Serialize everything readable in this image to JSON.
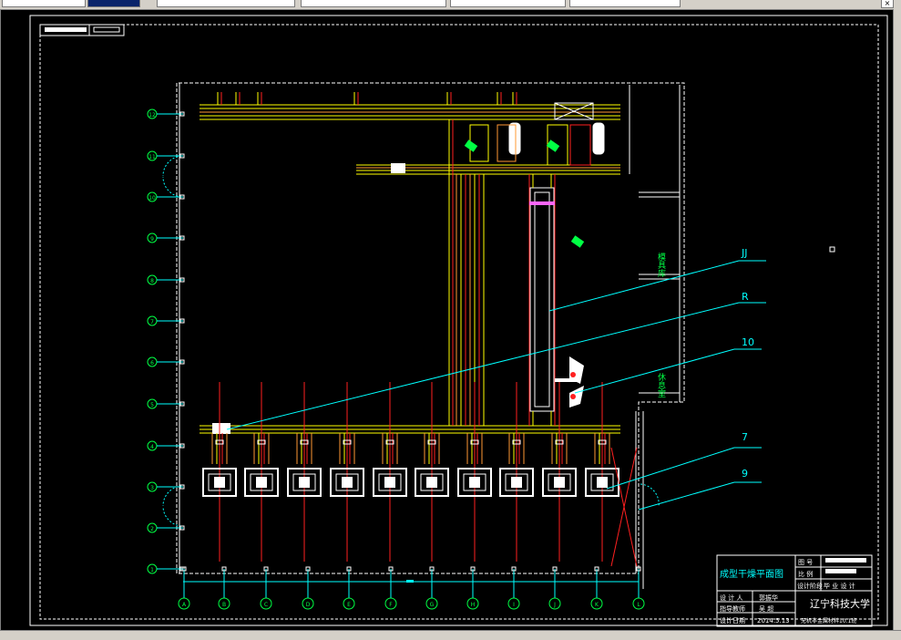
{
  "title_block": {
    "drawing_name": "成型干燥平面图",
    "school": "辽宁科技大学",
    "labels": [
      "设 计 人",
      "指导教师",
      "设计日期"
    ],
    "values": [
      "郭振华",
      "吴 超",
      "2014.5.13"
    ],
    "small_labels": [
      "图 号",
      "比 例",
      "设计阶段"
    ],
    "stage_value": "毕 业 设 计",
    "footer": "无机非金属材料10.1班"
  },
  "room_labels": {
    "tool_room": "模具库",
    "rest_room": "休息室"
  },
  "callouts": [
    "JJ",
    "R",
    "10",
    "7",
    "9"
  ],
  "grid_rows": [
    "14",
    "13",
    "12",
    "11",
    "10",
    "9",
    "8",
    "7",
    "6",
    "5",
    "4",
    "3",
    "2",
    "1"
  ],
  "grid_cols": [
    "A",
    "B",
    "C",
    "D",
    "E",
    "F",
    "G",
    "H",
    "I",
    "J",
    "K",
    "L"
  ],
  "colors": {
    "bg": "#000000",
    "frame": "#ffffff",
    "structure": "#ffff00",
    "red": "#ff2020",
    "orange": "#ff9933",
    "cyan": "#00ffff",
    "green": "#00ff44"
  }
}
